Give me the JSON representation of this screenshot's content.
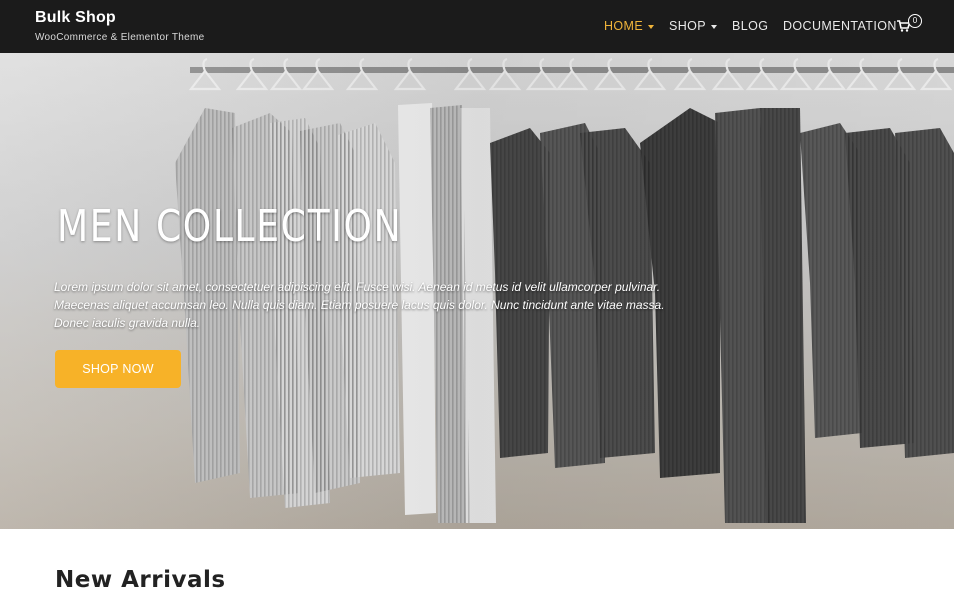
{
  "brand": {
    "title": "Bulk Shop",
    "tagline": "WooCommerce & Elementor Theme"
  },
  "nav": {
    "items": [
      {
        "label": "HOME",
        "active": true,
        "has_dropdown": true
      },
      {
        "label": "SHOP",
        "active": false,
        "has_dropdown": true
      },
      {
        "label": "BLOG",
        "active": false,
        "has_dropdown": false
      },
      {
        "label": "DOCUMENTATION",
        "active": false,
        "has_dropdown": false
      }
    ],
    "cart_count": "0",
    "cart_icon": "cart-icon"
  },
  "hero": {
    "title": "MEN COLLECTION",
    "text": "Lorem ipsum dolor sit amet, consectetuer adipiscing elit. Fusce wisi. Aenean id metus id velit ullamcorper pulvinar. Maecenas aliquet accumsan leo. Nulla quis diam. Etiam posuere lacus quis dolor. Nunc tincidunt ante vitae massa. Donec iaculis gravida nulla.",
    "button_label": "SHOP NOW"
  },
  "section": {
    "title": "New Arrivals"
  },
  "colors": {
    "header_bg": "#1b1b1b",
    "accent": "#f0b43a",
    "button": "#f7b228"
  }
}
